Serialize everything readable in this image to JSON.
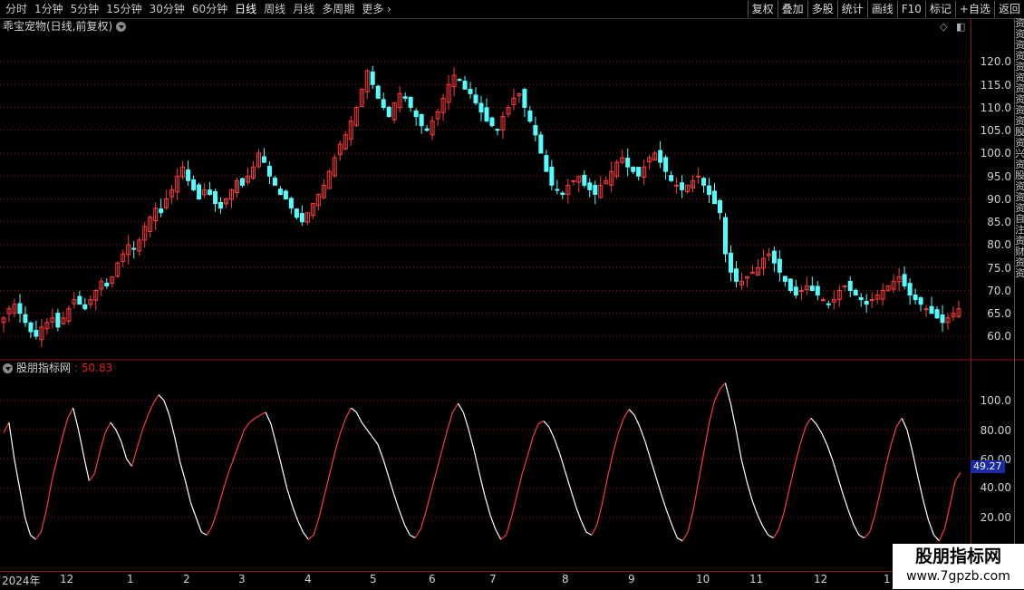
{
  "toolbar": {
    "periods": [
      "分时",
      "1分钟",
      "5分钟",
      "15分钟",
      "30分钟",
      "60分钟",
      "日线",
      "周线",
      "月线",
      "多周期",
      "更多"
    ],
    "active_period": "日线",
    "buttons": [
      "复权",
      "叠加",
      "多股",
      "统计",
      "画线",
      "F10",
      "标记",
      "+自选",
      "返回"
    ]
  },
  "price_panel": {
    "title": "乖宝宠物(日线,前复权)",
    "axis_labels": [
      "120.0",
      "115.0",
      "110.0",
      "105.0",
      "100.0",
      "95.0",
      "90.0",
      "85.0",
      "80.0",
      "75.0",
      "70.0",
      "65.0",
      "60.0"
    ]
  },
  "indicator_panel": {
    "name": "股朋指标网",
    "value_display": ": 50.83",
    "axis_labels": [
      "100.0",
      "80.00",
      "60.00",
      "40.00",
      "20.00"
    ],
    "current_tag": "49.27"
  },
  "time_axis": {
    "labels": [
      "2024年",
      "12",
      "1",
      "2",
      "3",
      "4",
      "5",
      "6",
      "7",
      "8",
      "9",
      "10",
      "11",
      "12",
      "1"
    ]
  },
  "side_strip": {
    "chars": [
      "资",
      "资",
      "资",
      "资",
      "资",
      "资",
      "资",
      "资",
      "资",
      "资",
      "股",
      "资",
      "兴",
      "资",
      "股",
      "资",
      "资",
      "资",
      "自",
      "注",
      "资",
      "财",
      "资",
      "资"
    ]
  },
  "watermark": {
    "title": "股朋指标网",
    "url": "www.7gpzb.com"
  },
  "colors": {
    "up": "#ff3b3b",
    "down": "#54ffff",
    "grid": "#8b1a1a",
    "axis_tag": "#1a2aa8"
  },
  "chart_data": [
    {
      "type": "candlestick",
      "title": "乖宝宠物(日线,前复权)",
      "ylim": [
        57,
        126
      ],
      "close_series": [
        64,
        66,
        67,
        65,
        63,
        61,
        60,
        62,
        63,
        64,
        62,
        64,
        66,
        68,
        67,
        66,
        68,
        70,
        72,
        71,
        73,
        76,
        78,
        80,
        79,
        81,
        84,
        86,
        88,
        87,
        90,
        92,
        95,
        97,
        94,
        92,
        90,
        92,
        91,
        89,
        88,
        90,
        92,
        94,
        93,
        95,
        97,
        100,
        98,
        95,
        93,
        91,
        90,
        88,
        86,
        85,
        87,
        89,
        91,
        93,
        96,
        99,
        102,
        104,
        107,
        110,
        114,
        118,
        115,
        112,
        110,
        108,
        111,
        113,
        112,
        110,
        108,
        106,
        105,
        107,
        109,
        112,
        115,
        117,
        116,
        114,
        113,
        111,
        109,
        107,
        106,
        105,
        108,
        110,
        112,
        113,
        110,
        107,
        104,
        100,
        96,
        93,
        92,
        91,
        93,
        94,
        95,
        93,
        92,
        91,
        93,
        94,
        96,
        98,
        99,
        97,
        96,
        95,
        97,
        99,
        100,
        98,
        96,
        94,
        93,
        92,
        93,
        94,
        95,
        93,
        91,
        89,
        87,
        78,
        74,
        72,
        72,
        73,
        74,
        75,
        77,
        78,
        76,
        74,
        72,
        70,
        69,
        70,
        71,
        70,
        69,
        68,
        67,
        68,
        70,
        71,
        70,
        69,
        68,
        67,
        68,
        69,
        70,
        71,
        72,
        73,
        71,
        69,
        68,
        67,
        66,
        65,
        64,
        63,
        64,
        65,
        66
      ],
      "y_ticks": [
        120,
        115,
        110,
        105,
        100,
        95,
        90,
        85,
        80,
        75,
        70,
        65,
        60
      ]
    },
    {
      "type": "line",
      "title": "股朋指标网",
      "ylim": [
        -5,
        115
      ],
      "last_value": 50.83,
      "current_cursor_value": 49.27,
      "series": [
        {
          "values": [
            78,
            85,
            60,
            40,
            20,
            8,
            5,
            10,
            25,
            45,
            60,
            75,
            88,
            95,
            80,
            62,
            45,
            50,
            65,
            78,
            85,
            80,
            72,
            60,
            55,
            68,
            80,
            90,
            98,
            104,
            100,
            90,
            75,
            58,
            45,
            30,
            20,
            10,
            8,
            14,
            25,
            38,
            50,
            60,
            70,
            80,
            85,
            88,
            90,
            92,
            84,
            70,
            55,
            40,
            28,
            18,
            10,
            5,
            8,
            20,
            35,
            50,
            65,
            78,
            88,
            95,
            92,
            85,
            80,
            75,
            70,
            60,
            48,
            36,
            25,
            15,
            8,
            6,
            12,
            24,
            38,
            52,
            66,
            80,
            92,
            98,
            92,
            80,
            66,
            50,
            35,
            22,
            12,
            5,
            8,
            20,
            35,
            50,
            62,
            75,
            84,
            86,
            82,
            74,
            64,
            52,
            40,
            28,
            18,
            10,
            8,
            15,
            30,
            48,
            64,
            78,
            88,
            94,
            90,
            82,
            72,
            60,
            48,
            36,
            25,
            15,
            6,
            4,
            10,
            25,
            45,
            65,
            85,
            100,
            108,
            112,
            98,
            80,
            60,
            45,
            32,
            22,
            14,
            8,
            6,
            12,
            24,
            40,
            56,
            70,
            82,
            88,
            84,
            78,
            70,
            60,
            48,
            36,
            25,
            15,
            8,
            6,
            10,
            22,
            38,
            55,
            70,
            82,
            88,
            80,
            65,
            48,
            32,
            18,
            8,
            4,
            12,
            28,
            45,
            50.83
          ]
        }
      ],
      "y_ticks": [
        100,
        80,
        60,
        40,
        20
      ]
    }
  ]
}
